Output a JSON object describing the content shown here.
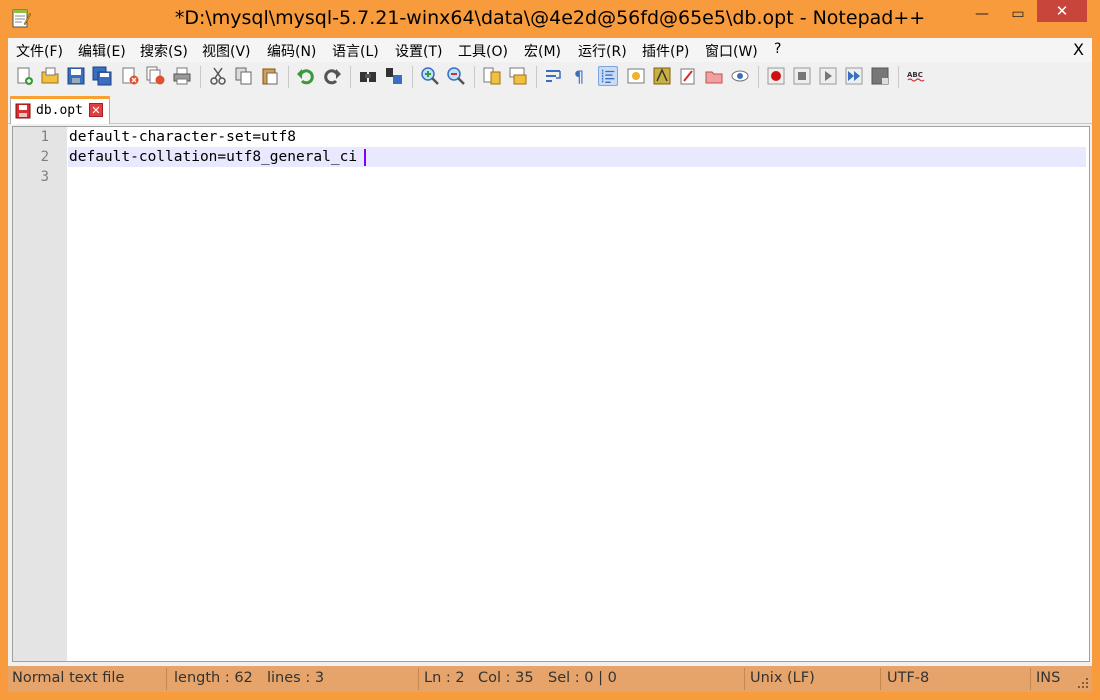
{
  "window": {
    "title": "*D:\\mysql\\mysql-5.7.21-winx64\\data\\@4e2d@56fd@65e5\\db.opt - Notepad++",
    "min_label": "—",
    "max_label": "▭",
    "close_label": "✕",
    "accent_color": "#f89b3c"
  },
  "menu": {
    "items": [
      "文件(F)",
      "编辑(E)",
      "搜索(S)",
      "视图(V)",
      "编码(N)",
      "语言(L)",
      "设置(T)",
      "工具(O)",
      "宏(M)",
      "运行(R)",
      "插件(P)",
      "窗口(W)",
      "?"
    ],
    "close_label": "X"
  },
  "toolbar": {
    "buttons": [
      "new-file-icon",
      "open-file-icon",
      "save-icon",
      "save-all-icon",
      "close-icon",
      "close-all-icon",
      "print-icon",
      "cut-icon",
      "copy-icon",
      "paste-icon",
      "undo-icon",
      "redo-icon",
      "find-icon",
      "replace-icon",
      "zoom-in-icon",
      "zoom-out-icon",
      "sync-v-icon",
      "sync-h-icon",
      "word-wrap-icon",
      "show-all-chars-icon",
      "indent-guide-icon",
      "doc-map-icon",
      "function-list-icon",
      "folder-workspace-icon",
      "monitor-icon",
      "eye-icon",
      "record-macro-icon",
      "stop-record-icon",
      "play-macro-icon",
      "run-macro-multiple-icon",
      "save-macro-icon",
      "spell-check-icon"
    ]
  },
  "tab": {
    "label": "db.opt",
    "close_label": "✕"
  },
  "editor": {
    "line_numbers": [
      "1",
      "2",
      "3"
    ],
    "lines": [
      "default-character-set=utf8",
      "default-collation=utf8_general_ci",
      ""
    ],
    "current_line": 2
  },
  "status": {
    "file_type": "Normal text file",
    "length": "length : 62",
    "lines": "lines : 3",
    "ln": "Ln : 2",
    "col": "Col : 35",
    "sel": "Sel : 0 | 0",
    "eol": "Unix (LF)",
    "encoding": "UTF-8",
    "mode": "INS"
  }
}
